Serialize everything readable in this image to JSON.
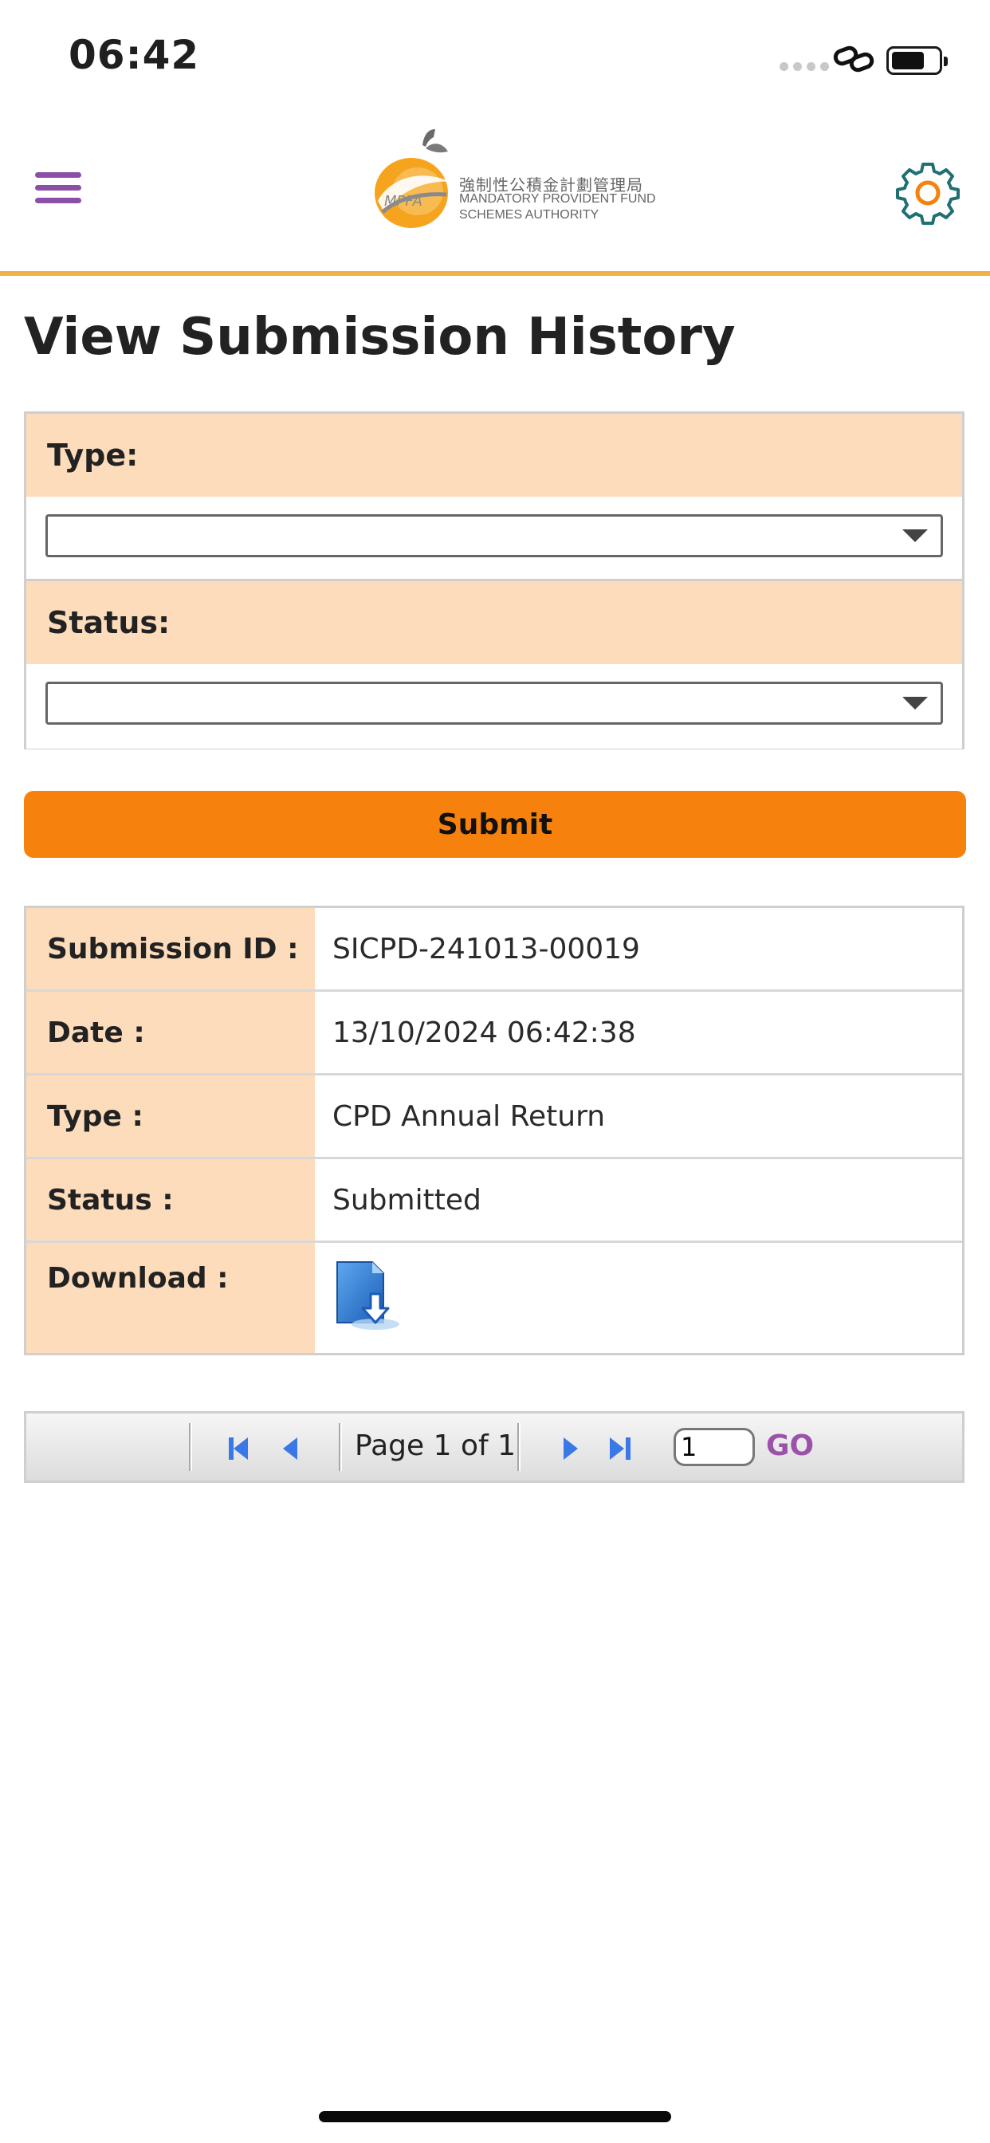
{
  "status_bar": {
    "time": "06:42"
  },
  "header": {
    "logo_cjk": "強制性公積金計劃管理局",
    "logo_en_line1": "MANDATORY PROVIDENT FUND",
    "logo_en_line2": "SCHEMES AUTHORITY",
    "logo_mark": "MPFA",
    "accent_color": "#f0b04a",
    "menu_color": "#8c4fa8"
  },
  "page": {
    "title": "View Submission History"
  },
  "filters": {
    "type_label": "Type:",
    "type_value": "",
    "status_label": "Status:",
    "status_value": "",
    "submit_label": "Submit"
  },
  "result": {
    "rows": [
      {
        "label": "Submission ID :",
        "value": "SICPD-241013-00019"
      },
      {
        "label": "Date :",
        "value": "13/10/2024 06:42:38"
      },
      {
        "label": "Type :",
        "value": "CPD Annual Return"
      },
      {
        "label": "Status :",
        "value": "Submitted"
      },
      {
        "label": "Download :",
        "icon": "download-document-icon"
      }
    ]
  },
  "pager": {
    "page_info": "Page 1 of 1",
    "page_input": "1",
    "go_label": "GO"
  },
  "colors": {
    "label_bg": "#fddcbc",
    "submit_bg": "#f6820d",
    "pager_icon": "#3b78e7",
    "go": "#9b52a8"
  }
}
